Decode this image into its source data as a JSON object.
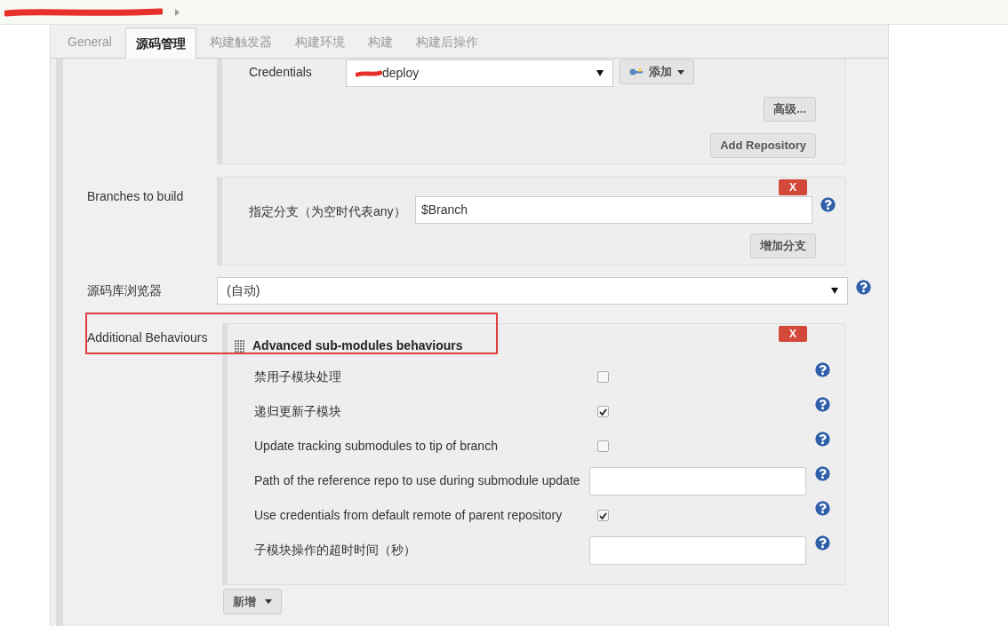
{
  "tabs": [
    {
      "label": "General",
      "selected": false
    },
    {
      "label": "源码管理",
      "selected": true
    },
    {
      "label": "构建触发器",
      "selected": false
    },
    {
      "label": "构建环境",
      "selected": false
    },
    {
      "label": "构建",
      "selected": false
    },
    {
      "label": "构建后操作",
      "selected": false
    }
  ],
  "credentials": {
    "label": "Credentials",
    "value": "deploy",
    "add_button": "添加",
    "advanced_button": "高级...",
    "add_repository_button": "Add Repository"
  },
  "branches": {
    "label": "Branches to build",
    "delete_button": "X",
    "field_label": "指定分支（为空时代表any）",
    "value": "$Branch",
    "add_button": "增加分支"
  },
  "repo_browser": {
    "label": "源码库浏览器",
    "value": "(自动)"
  },
  "additional_behaviours": {
    "label": "Additional Behaviours",
    "highlighted": true,
    "delete_button": "X",
    "title": "Advanced sub-modules behaviours",
    "add_button": "新增",
    "options": [
      {
        "kind": "checkbox",
        "label": "禁用子模块处理",
        "checked": false
      },
      {
        "kind": "checkbox",
        "label": "递归更新子模块",
        "checked": true
      },
      {
        "kind": "checkbox",
        "label": "Update tracking submodules to tip of branch",
        "checked": false
      },
      {
        "kind": "text",
        "label": "Path of the reference repo to use during submodule update"
      },
      {
        "kind": "checkbox",
        "label": "Use credentials from default remote of parent repository",
        "checked": true
      },
      {
        "kind": "text",
        "label": "子模块操作的超时时间（秒）"
      }
    ]
  }
}
